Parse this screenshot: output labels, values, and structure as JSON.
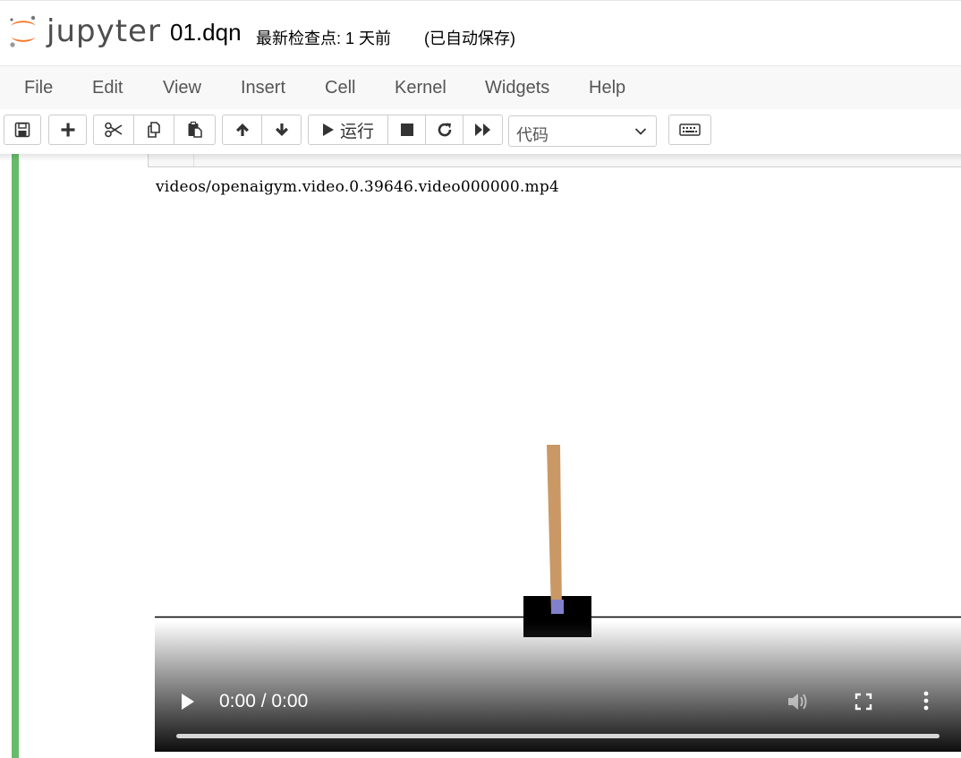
{
  "header": {
    "logo_text": "jupyter",
    "notebook_name": "01.dqn",
    "checkpoint": "最新检查点: 1 天前",
    "autosave": "(已自动保存)"
  },
  "menubar": {
    "items": [
      "File",
      "Edit",
      "View",
      "Insert",
      "Cell",
      "Kernel",
      "Widgets",
      "Help"
    ]
  },
  "toolbar": {
    "run_label": "运行",
    "cell_type": "代码"
  },
  "output": {
    "text": "videos/openaigym.video.0.39646.video000000.mp4"
  },
  "video": {
    "time": "0:00 / 0:00",
    "progress": 0
  },
  "colors": {
    "cell_bar": "#66bb6a",
    "pole": "#ca9865",
    "axle": "#8181cb",
    "cart": "#000000"
  },
  "icons": {
    "save": "save-icon",
    "add": "plus-icon",
    "cut": "scissors-icon",
    "copy": "copy-icon",
    "paste": "paste-icon",
    "move_up": "arrow-up-icon",
    "move_down": "arrow-down-icon",
    "run": "play-icon",
    "stop": "stop-icon",
    "restart": "restart-icon",
    "run_all": "fast-forward-icon",
    "keyboard": "keyboard-icon"
  }
}
